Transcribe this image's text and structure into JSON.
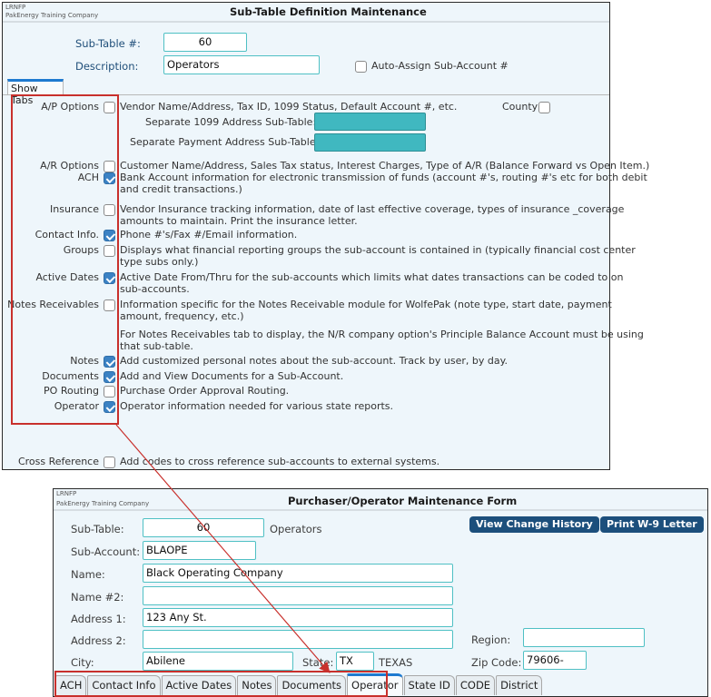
{
  "window1": {
    "company_code": "LRNFP",
    "company_name": "PakEnergy Training Company",
    "title": "Sub-Table Definition Maintenance",
    "sub_table_label": "Sub-Table #:",
    "sub_table_value": "60",
    "description_label": "Description:",
    "description_value": "Operators",
    "auto_assign_label": "Auto-Assign Sub-Account #",
    "auto_assign_checked": false,
    "show_tabs_label": "Show Tabs",
    "county_label": "County",
    "county_checked": false,
    "separate_1099_label": "Separate 1099 Address Sub-Table:",
    "separate_payment_label": "Separate Payment Address Sub-Table:",
    "options": [
      {
        "label": "A/P Options",
        "checked": false,
        "desc": [
          "Vendor Name/Address, Tax ID, 1099 Status, Default Account #, etc."
        ]
      },
      {
        "label": "A/R Options",
        "checked": false,
        "desc": [
          "Customer Name/Address, Sales Tax status, Interest Charges, Type of A/R (Balance Forward vs Open Item.)"
        ]
      },
      {
        "label": "ACH",
        "checked": true,
        "desc": [
          "Bank Account information for electronic transmission of funds (account #'s, routing #'s etc for both debit",
          "and credit transactions.)"
        ]
      },
      {
        "label": "Insurance",
        "checked": false,
        "desc": [
          "Vendor Insurance tracking information, date of last effective coverage, types of insurance _coverage",
          "amounts to maintain.  Print the insurance letter."
        ]
      },
      {
        "label": "Contact Info.",
        "checked": true,
        "desc": [
          "Phone #'s/Fax #/Email information."
        ]
      },
      {
        "label": "Groups",
        "checked": false,
        "desc": [
          "Displays what financial reporting groups the sub-account is contained in (typically financial cost center",
          "type subs only.)"
        ]
      },
      {
        "label": "Active Dates",
        "checked": true,
        "desc": [
          "Active Date From/Thru for the sub-accounts which limits what dates transactions can be coded to on",
          "sub-accounts."
        ]
      },
      {
        "label": "Notes Receivables",
        "checked": false,
        "desc": [
          "Information specific  for the Notes Receivable module for WolfePak (note type, start date, payment",
          "amount, frequency, etc.)"
        ]
      },
      {
        "label": "",
        "checked": null,
        "desc": [
          "For Notes Receivables tab to display, the N/R company option's Principle Balance Account must be using",
          "that sub-table."
        ]
      },
      {
        "label": "Notes",
        "checked": true,
        "desc": [
          "Add customized personal notes about the sub-account.  Track by user, by day."
        ]
      },
      {
        "label": "Documents",
        "checked": true,
        "desc": [
          "Add and View Documents for a Sub-Account."
        ]
      },
      {
        "label": "PO Routing",
        "checked": false,
        "desc": [
          "Purchase Order Approval Routing."
        ]
      },
      {
        "label": "Operator",
        "checked": true,
        "desc": [
          "Operator information needed for various state reports."
        ]
      },
      {
        "label": "Cross Reference",
        "checked": false,
        "desc": [
          "Add codes to cross reference sub-accounts to external systems."
        ]
      }
    ]
  },
  "window2": {
    "company_code": "LRNFP",
    "company_name": "PakEnergy Training Company",
    "title": "Purchaser/Operator Maintenance Form",
    "buttons": {
      "view_change_history": "View Change History",
      "print_w9": "Print W-9 Letter"
    },
    "fields": {
      "sub_table_label": "Sub-Table:",
      "sub_table_value": "60",
      "sub_table_desc": "Operators",
      "sub_account_label": "Sub-Account:",
      "sub_account_value": "BLAOPE",
      "name_label": "Name:",
      "name_value": "Black Operating Company",
      "name2_label": "Name #2:",
      "name2_value": "",
      "address1_label": "Address 1:",
      "address1_value": "123 Any St.",
      "address2_label": "Address 2:",
      "address2_value": "",
      "city_label": "City:",
      "city_value": "Abilene",
      "state_label": "State:",
      "state_value": "TX",
      "state_name": "TEXAS",
      "region_label": "Region:",
      "region_value": "",
      "zip_label": "Zip Code:",
      "zip_value": "79606-"
    },
    "tabs": [
      {
        "label": "ACH",
        "active": false
      },
      {
        "label": "Contact Info",
        "active": false
      },
      {
        "label": "Active Dates",
        "active": false
      },
      {
        "label": "Notes",
        "active": false
      },
      {
        "label": "Documents",
        "active": false
      },
      {
        "label": "Operator",
        "active": true
      },
      {
        "label": "State ID",
        "active": false
      },
      {
        "label": "CODE",
        "active": false
      },
      {
        "label": "District",
        "active": false
      }
    ]
  },
  "annotation": {
    "highlight_color": "#c8302c"
  }
}
